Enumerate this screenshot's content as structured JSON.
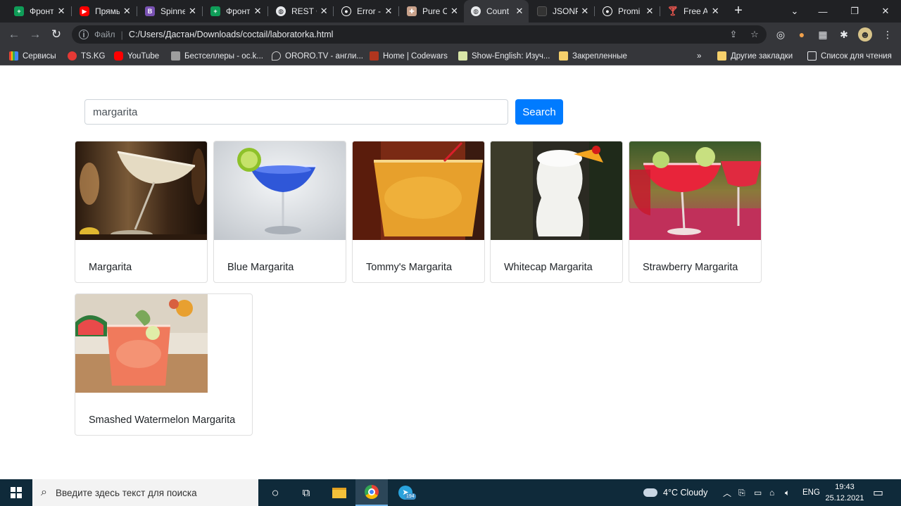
{
  "tabs": [
    {
      "title": "Фронт",
      "icon": "sheets-icon",
      "color": "#0f9d58"
    },
    {
      "title": "Прямь",
      "icon": "youtube-icon",
      "color": "#ff0000"
    },
    {
      "title": "Spinne",
      "icon": "bootstrap-icon",
      "color": "#7952b3"
    },
    {
      "title": "Фронт",
      "icon": "sheets-icon",
      "color": "#0f9d58"
    },
    {
      "title": "REST C",
      "icon": "globe-icon",
      "color": "#e8eaed"
    },
    {
      "title": "Error -",
      "icon": "mdn-icon",
      "color": "#ffffff"
    },
    {
      "title": "Pure C",
      "icon": "pure-icon",
      "color": "#c9a28b"
    },
    {
      "title": "Count",
      "icon": "globe-icon",
      "color": "#e8eaed"
    },
    {
      "title": "JSONP",
      "icon": "json-icon",
      "color": "#333333"
    },
    {
      "title": "Promi",
      "icon": "mdn-icon",
      "color": "#ffffff"
    },
    {
      "title": "Free A",
      "icon": "cocktail-icon",
      "color": "#e8554e"
    }
  ],
  "toolbar": {
    "scheme": "Файл",
    "url": "C:/Users/Дастан/Downloads/coctail/laboratorka.html"
  },
  "bookmarks": [
    {
      "label": "Сервисы",
      "icon": "apps-icon"
    },
    {
      "label": "TS.KG",
      "icon": "tskg-icon"
    },
    {
      "label": "YouTube",
      "icon": "youtube-icon"
    },
    {
      "label": "Бестселлеры - ос.k...",
      "icon": "book-icon"
    },
    {
      "label": "ORORO.TV - англи...",
      "icon": "ororo-icon"
    },
    {
      "label": "Home | Codewars",
      "icon": "codewars-icon"
    },
    {
      "label": "Show-English: Изуч...",
      "icon": "show-english-icon"
    },
    {
      "label": "Закрепленные",
      "icon": "folder-icon"
    },
    {
      "label": "»",
      "icon": "overflow-icon"
    },
    {
      "label": "Другие закладки",
      "icon": "folder-icon"
    },
    {
      "label": "Список для чтения",
      "icon": "reading-list-icon"
    }
  ],
  "search": {
    "value": "margarita",
    "button_label": "Search"
  },
  "cocktails": [
    {
      "name": "Margarita",
      "image": "margarita-photo"
    },
    {
      "name": "Blue Margarita",
      "image": "blue-margarita-photo"
    },
    {
      "name": "Tommy's Margarita",
      "image": "tommys-margarita-photo"
    },
    {
      "name": "Whitecap Margarita",
      "image": "whitecap-margarita-photo"
    },
    {
      "name": "Strawberry Margarita",
      "image": "strawberry-margarita-photo"
    },
    {
      "name": "Smashed Watermelon Margarita",
      "image": "smashed-watermelon-margarita-photo"
    }
  ],
  "taskbar": {
    "search_placeholder": "Введите здесь текст для поиска",
    "telegram_badge": "194",
    "weather": "4°C  Cloudy",
    "language": "ENG",
    "time": "19:43",
    "date": "25.12.2021"
  },
  "colors": {
    "accent": "#007bff",
    "chrome_dark": "#202124",
    "chrome_toolbar": "#35363a",
    "taskbar": "#0f2a3a"
  }
}
